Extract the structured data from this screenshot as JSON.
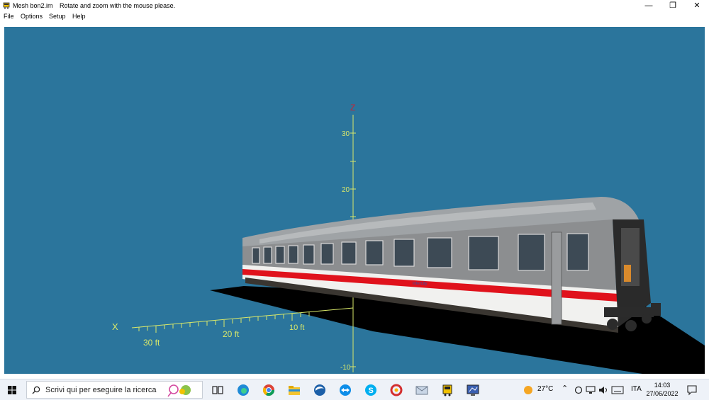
{
  "window": {
    "title": "Mesh bon2.im",
    "hint": "Rotate and zoom with the mouse please.",
    "controls": {
      "minimize": "—",
      "restore": "❐",
      "close": "✕"
    }
  },
  "menu": [
    "File",
    "Options",
    "Setup",
    "Help"
  ],
  "scene": {
    "background_color": "#2b759c",
    "axis_color": "#d9e86a",
    "z_axis_label": "Z",
    "x_axis_label": "X",
    "z_ticks": [
      "30",
      "20",
      "-10"
    ],
    "x_ticks": [
      "30 ft",
      "20 ft",
      "10 ft"
    ],
    "model": "passenger coach",
    "coach_logo": "intercity"
  },
  "taskbar": {
    "search_placeholder": "Scrivi qui per eseguire la ricerca",
    "weather": "27°C",
    "language": "ITA",
    "time": "14:03",
    "date": "27/06/2022",
    "apps": [
      "task-view",
      "edge",
      "chrome",
      "file-explorer",
      "browser",
      "teamviewer",
      "skype",
      "app-red",
      "mail",
      "train-sim",
      "mesh-viewer"
    ]
  }
}
